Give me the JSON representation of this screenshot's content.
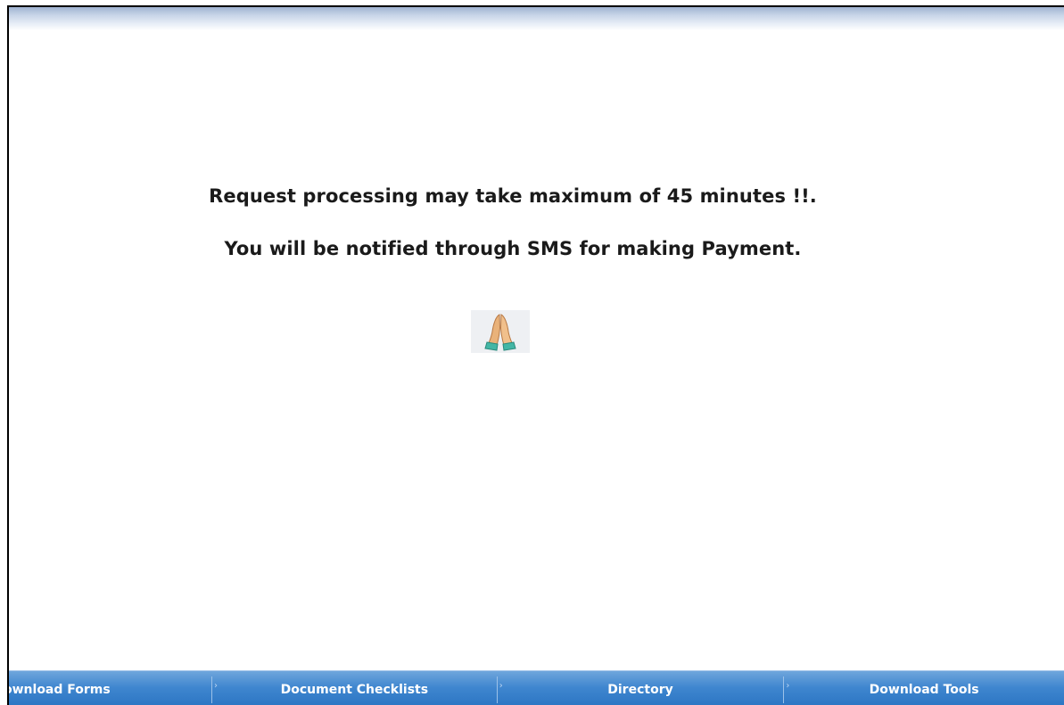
{
  "messages": {
    "line1": "Request processing may take maximum of 45 minutes !!.",
    "line2": "You will be notified through SMS for making Payment."
  },
  "emoji": {
    "icon": "folded-hands-icon"
  },
  "nav": {
    "items": [
      {
        "label": "ownload Forms"
      },
      {
        "label": "Document Checklists"
      },
      {
        "label": "Directory"
      },
      {
        "label": "Download Tools"
      }
    ],
    "separator_glyph": "›"
  },
  "colors": {
    "nav_bar": "#3f86cf",
    "nav_text": "#ffffff",
    "message_text": "#1a1a1a",
    "frame_border": "#000000"
  }
}
